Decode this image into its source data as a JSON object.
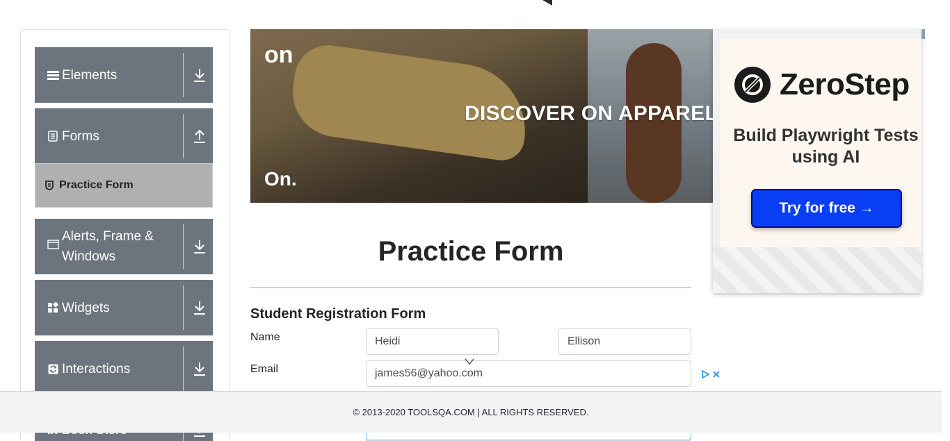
{
  "sidebar": {
    "groups": [
      {
        "label": "Elements",
        "icon": "hamburger-icon",
        "toggle": "download-arrow-icon"
      },
      {
        "label": "Forms",
        "icon": "document-icon",
        "toggle": "upload-arrow-icon"
      },
      {
        "label": "Alerts, Frame & Windows",
        "icon": "window-icon",
        "toggle": "download-arrow-icon"
      },
      {
        "label": "Widgets",
        "icon": "widgets-icon",
        "toggle": "download-arrow-icon"
      },
      {
        "label": "Interactions",
        "icon": "interactions-icon",
        "toggle": "download-arrow-icon"
      },
      {
        "label": "Book Store",
        "icon": "book-icon",
        "toggle": "download-arrow-icon"
      }
    ],
    "active_subitem": {
      "label": "Practice Form",
      "icon": "shield-icon"
    }
  },
  "banner": {
    "logo_top": "on",
    "headline": "DISCOVER ON APPAREL",
    "logo_bottom": "On."
  },
  "ad": {
    "brand": "ZeroStep",
    "tagline": "Build Playwright Tests using AI",
    "cta": "Try for free →"
  },
  "main": {
    "title": "Practice Form",
    "subtitle": "Student Registration Form",
    "name_label": "Name",
    "first_name": "Heidi",
    "last_name": "Ellison",
    "email_label": "Email",
    "email": "james56@yahoo.com"
  },
  "footer": {
    "text": "© 2013-2020 TOOLSQA.COM | ALL RIGHTS RESERVED."
  },
  "colors": {
    "sidebar_group": "#6c757d",
    "sidebar_active": "#b0b0b0",
    "cta_blue": "#0a3ef5",
    "footer_bg": "#f3f3f3"
  }
}
